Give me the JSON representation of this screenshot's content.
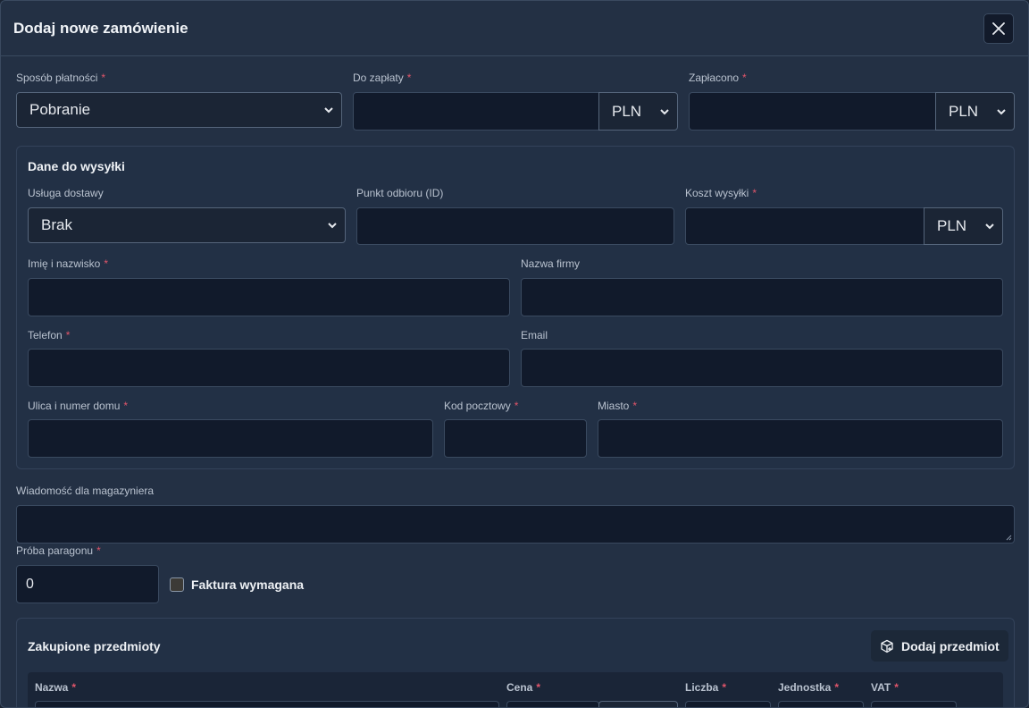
{
  "modal": {
    "title": "Dodaj nowe zamówienie",
    "close_icon": "close-icon"
  },
  "payment": {
    "method_label": "Sposób płatności",
    "method_value": "Pobranie",
    "to_pay_label": "Do zapłaty",
    "to_pay_value": "",
    "to_pay_currency": "PLN",
    "paid_label": "Zapłacono",
    "paid_value": "",
    "paid_currency": "PLN",
    "required_mark": "*"
  },
  "shipping": {
    "title": "Dane do wysyłki",
    "service_label": "Usługa dostawy",
    "service_value": "Brak",
    "pickup_label": "Punkt odbioru (ID)",
    "cost_label": "Koszt wysyłki",
    "cost_currency": "PLN",
    "name_label": "Imię i nazwisko",
    "company_label": "Nazwa firmy",
    "phone_label": "Telefon",
    "email_label": "Email",
    "street_label": "Ulica i numer domu",
    "postal_label": "Kod pocztowy",
    "city_label": "Miasto"
  },
  "message": {
    "label": "Wiadomość dla magazyniera"
  },
  "receipt": {
    "label": "Próba paragonu",
    "value": "0",
    "invoice_label": "Faktura wymagana"
  },
  "items": {
    "title": "Zakupione przedmioty",
    "add_label": "Dodaj przedmiot",
    "add_icon": "package-plus-icon",
    "columns": [
      "Nazwa",
      "Cena",
      "Liczba",
      "Jednostka",
      "VAT"
    ]
  }
}
